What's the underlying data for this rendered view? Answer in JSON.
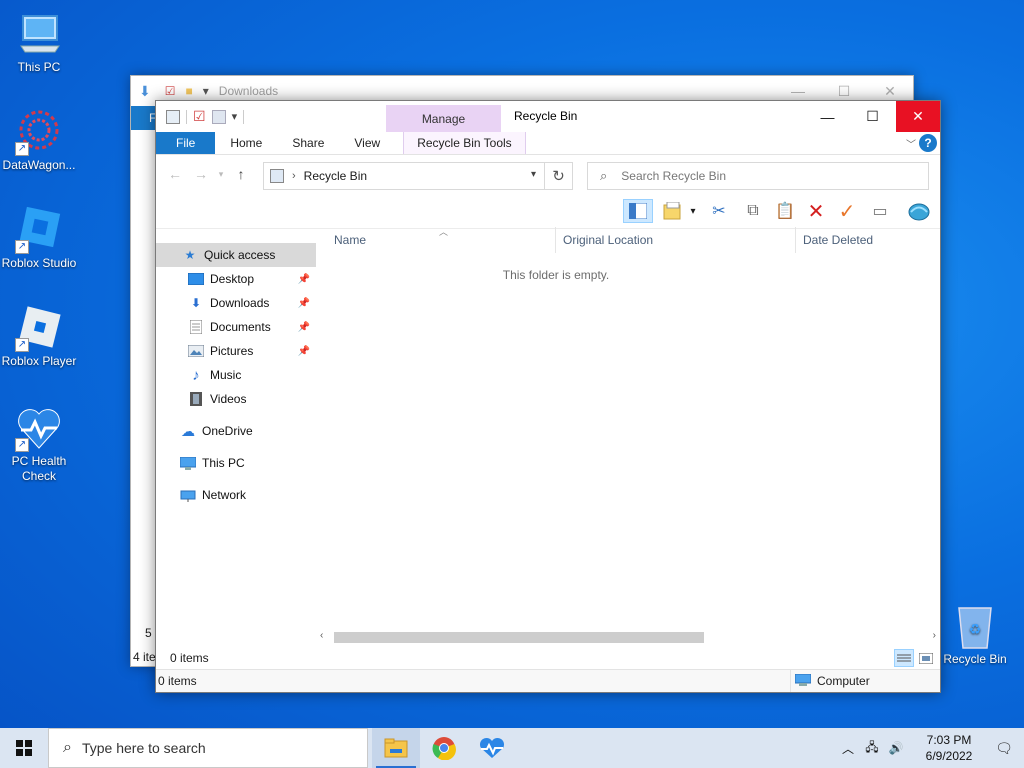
{
  "desktop": {
    "icons": [
      {
        "label": "This PC"
      },
      {
        "label": "DataWagon..."
      },
      {
        "label": "Roblox Studio"
      },
      {
        "label": "Roblox Player"
      },
      {
        "label": "PC Health Check"
      },
      {
        "label": "Recycle Bin"
      }
    ]
  },
  "back_window": {
    "title": "Downloads",
    "tab_letter": "F",
    "status_items": "4 ite",
    "status_partial": "5 i"
  },
  "window": {
    "title": "Recycle Bin",
    "ribbon": {
      "context_tab": "Manage",
      "tabs": [
        "File",
        "Home",
        "Share",
        "View",
        "Recycle Bin Tools"
      ]
    },
    "address": {
      "path": "Recycle Bin",
      "search_placeholder": "Search Recycle Bin"
    },
    "nav": {
      "quick_access": "Quick access",
      "items": [
        "Desktop",
        "Downloads",
        "Documents",
        "Pictures",
        "Music",
        "Videos"
      ],
      "onedrive": "OneDrive",
      "this_pc": "This PC",
      "network": "Network"
    },
    "columns": [
      "Name",
      "Original Location",
      "Date Deleted"
    ],
    "empty_message": "This folder is empty.",
    "status": {
      "items": "0 items",
      "items2": "0 items",
      "zone": "Computer"
    }
  },
  "taskbar": {
    "search_placeholder": "Type here to search",
    "time": "7:03 PM",
    "date": "6/9/2022"
  },
  "colors": {
    "accent": "#1979ca",
    "close": "#e81123",
    "manage": "#e9d3f4"
  }
}
